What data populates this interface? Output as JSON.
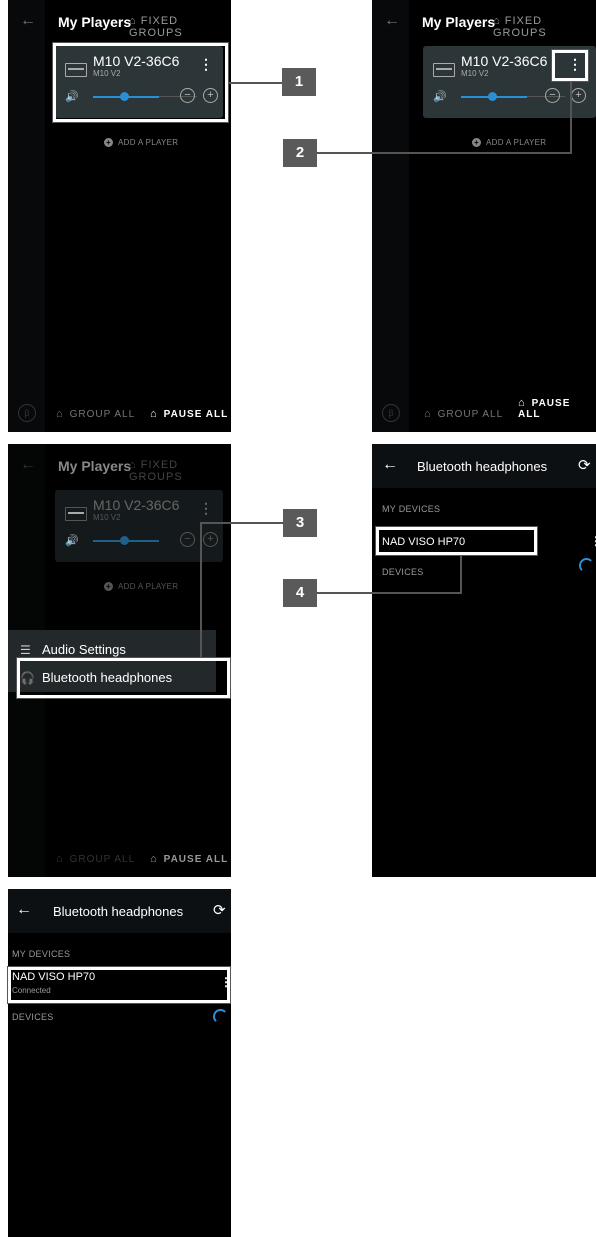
{
  "players_screen": {
    "title": "My Players",
    "fixed_groups": "FIXED GROUPS",
    "player_name": "M10 V2-36C6",
    "player_model": "M10 V2",
    "add_player": "ADD A PLAYER",
    "group_all": "GROUP ALL",
    "pause_all": "PAUSE ALL",
    "volume_level": 0.6
  },
  "menu": {
    "audio_settings": "Audio Settings",
    "bluetooth_headphones": "Bluetooth headphones"
  },
  "bluetooth_screen": {
    "title": "Bluetooth headphones",
    "my_devices": "MY DEVICES",
    "devices": "DEVICES",
    "device_name": "NAD VISO HP70",
    "connected": "Connected"
  },
  "callouts": [
    "1",
    "2",
    "3",
    "4"
  ],
  "colors": {
    "accent": "#2b8fd6",
    "card": "#2c3538",
    "background": "#000000"
  }
}
